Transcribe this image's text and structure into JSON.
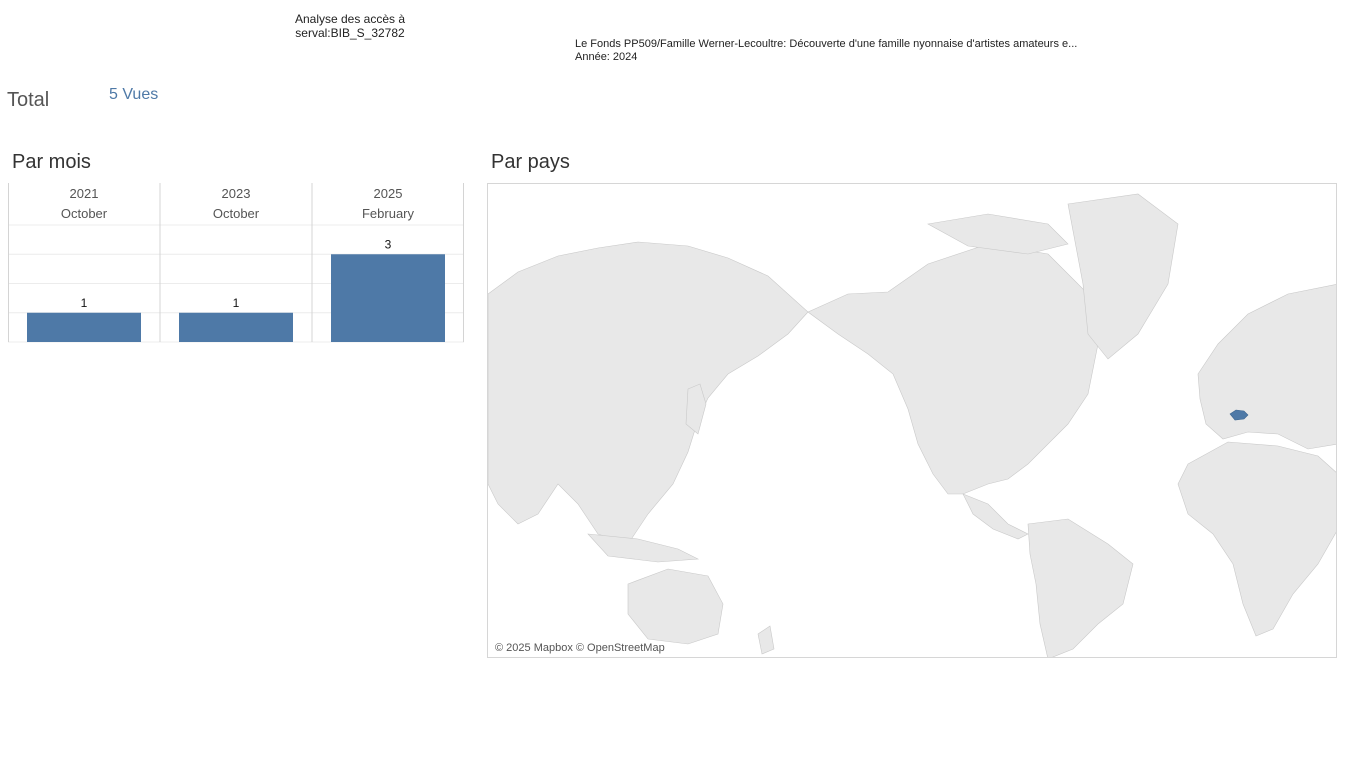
{
  "header": {
    "analysis_title_line1": "Analyse des accès à",
    "analysis_title_line2": "serval:BIB_S_32782",
    "doc_title": "Le Fonds PP509/Famille Werner-Lecoultre: Découverte d'une famille nyonnaise d'artistes amateurs e...",
    "doc_year": "Année: 2024"
  },
  "total": {
    "label": "Total",
    "value": "5 Vues"
  },
  "sections": {
    "by_month": "Par mois",
    "by_country": "Par pays"
  },
  "chart_data": {
    "type": "bar",
    "title": "Par mois",
    "years": [
      "2021",
      "2023",
      "2025"
    ],
    "categories": [
      "October",
      "October",
      "February"
    ],
    "values": [
      1,
      1,
      3
    ],
    "data_labels": [
      "1",
      "1",
      "3"
    ],
    "ylim": [
      0,
      4
    ],
    "grid": true,
    "bar_color": "#4e79a7"
  },
  "map": {
    "highlighted_country": "Switzerland",
    "highlight_color": "#4e79a7",
    "land_color": "#e8e8e8",
    "attribution": "© 2025 Mapbox © OpenStreetMap"
  }
}
